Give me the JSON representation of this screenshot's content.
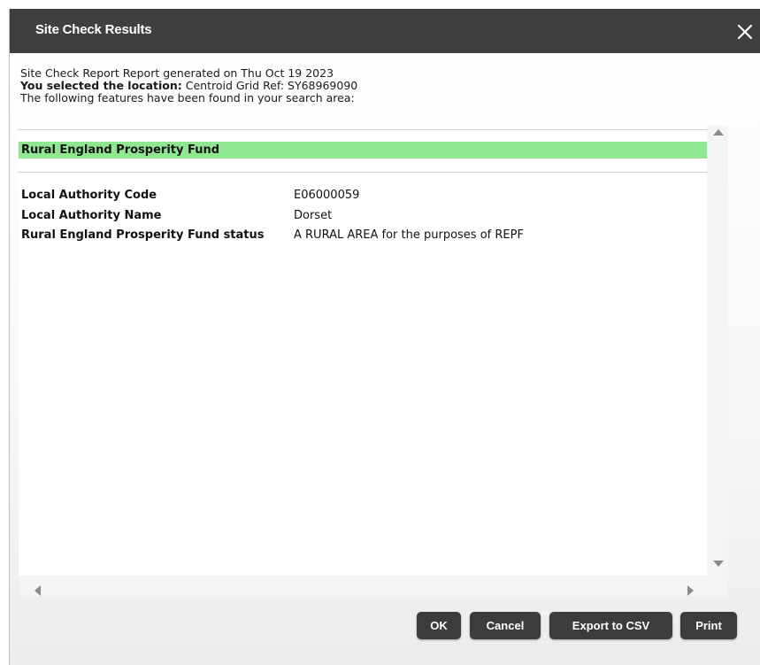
{
  "dialog": {
    "title": "Site Check Results",
    "close_icon": "close-icon"
  },
  "report": {
    "generated_line": "Site Check Report Report generated on Thu Oct 19 2023",
    "location_label": "You selected the location:",
    "location_value": " Centroid Grid Ref: SY68969090",
    "features_line": "The following features have been found in your search area:"
  },
  "section": {
    "title": "Rural England Prosperity Fund",
    "highlight_color": "#8fe88f",
    "rows": [
      {
        "label": "Local Authority Code",
        "value": "E06000059"
      },
      {
        "label": "Local Authority Name",
        "value": "Dorset"
      },
      {
        "label": "Rural England Prosperity Fund status",
        "value": "A RURAL AREA for the purposes of REPF"
      }
    ]
  },
  "buttons": {
    "ok": "OK",
    "cancel": "Cancel",
    "export": "Export to CSV",
    "print": "Print"
  }
}
